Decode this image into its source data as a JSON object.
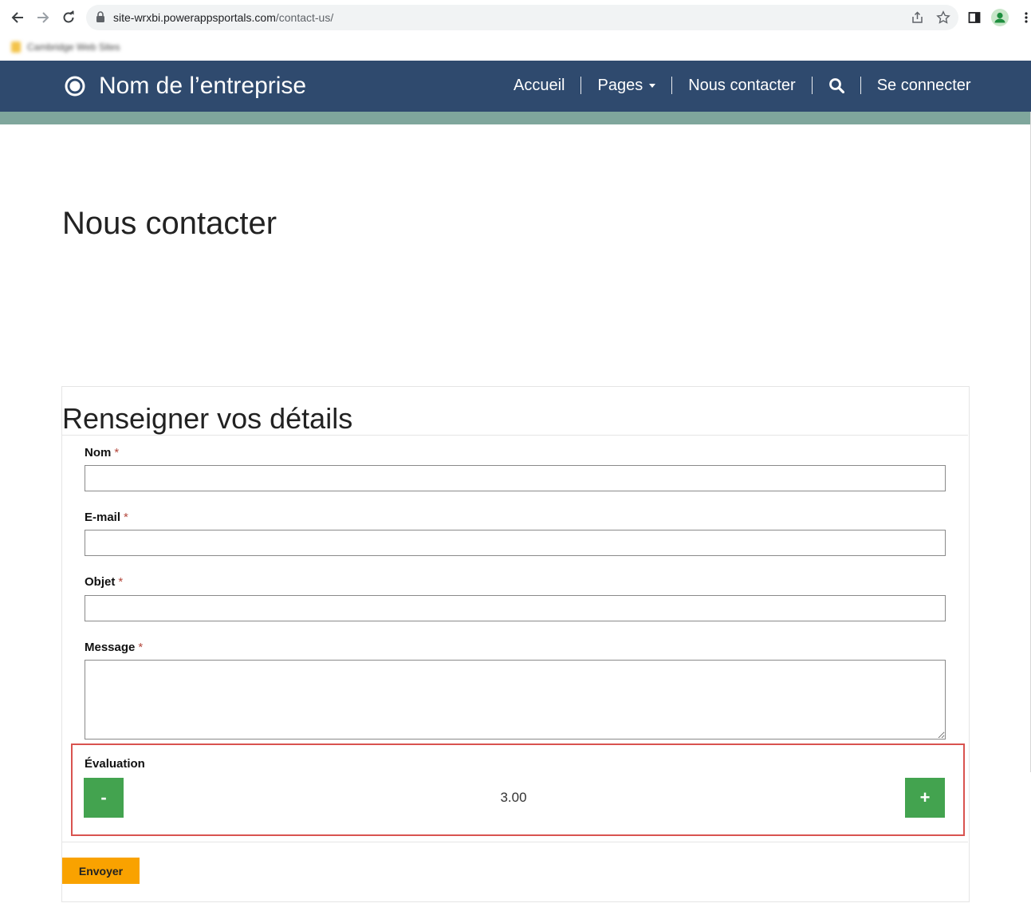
{
  "browser": {
    "url_host": "site-wrxbi.powerappsportals.com",
    "url_path": "/contact-us/",
    "bookmark_label": "Cambridge Web Sites",
    "icons": [
      "back-icon",
      "forward-icon",
      "reload-icon",
      "lock-icon",
      "share-icon",
      "star-icon",
      "side-panel-icon",
      "profile-icon",
      "menu-dots-icon"
    ]
  },
  "header": {
    "brand_name": "Nom de l’entreprise",
    "nav": {
      "home": "Accueil",
      "pages": "Pages",
      "contact": "Nous contacter",
      "signin": "Se connecter"
    },
    "colors": {
      "header_bg": "#2f4a6e",
      "accent_strip": "#7fa69c"
    }
  },
  "page": {
    "title": "Nous contacter"
  },
  "form": {
    "section_title": "Renseigner vos détails",
    "required_marker": "*",
    "fields": {
      "name": {
        "label": "Nom",
        "value": ""
      },
      "email": {
        "label": "E-mail",
        "value": ""
      },
      "subject": {
        "label": "Objet",
        "value": ""
      },
      "message": {
        "label": "Message",
        "value": ""
      }
    },
    "rating": {
      "label": "Évaluation",
      "minus": "-",
      "plus": "+",
      "value": "3.00"
    },
    "submit_label": "Envoyer",
    "colors": {
      "stepper": "#43a34f",
      "submit": "#f9a200",
      "highlight": "#d9534f",
      "required": "#b4483d"
    }
  }
}
